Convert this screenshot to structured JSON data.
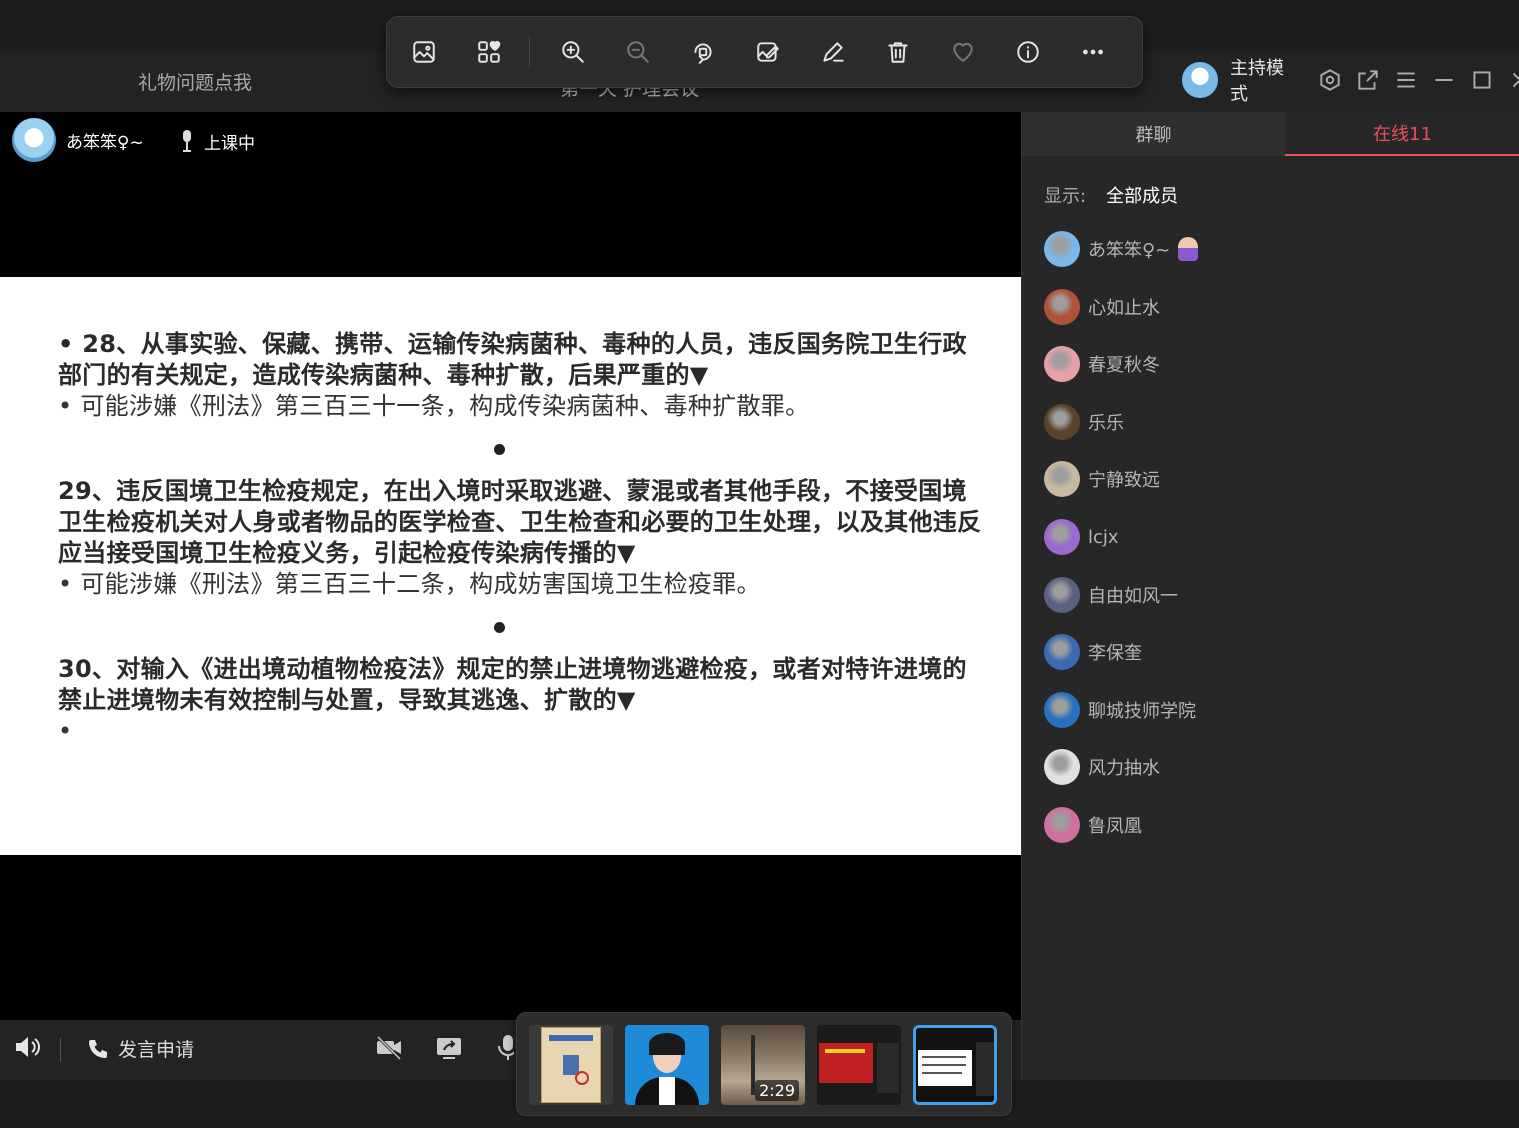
{
  "window": {
    "gift_link": "礼物问题点我",
    "center_title": "第一天 护理会议",
    "host_mode_label": "主持模式"
  },
  "viewer_toolbar": {
    "buttons": [
      "image-icon",
      "apps-heart-icon",
      "zoom-in-icon",
      "zoom-out-icon",
      "rotate-icon",
      "edit-image-icon",
      "draw-icon",
      "delete-icon",
      "favorite-icon",
      "info-icon",
      "more-icon"
    ]
  },
  "presenter": {
    "name": "あ笨笨♀~",
    "status": "上课中"
  },
  "slide": {
    "item28_title": "•   28、从事实验、保藏、携带、运输传染病菌种、毒种的人员，违反国务院卫生行政部门的有关规定，造成传染病菌种、毒种扩散，后果严重的▼",
    "item28_answer": "•   可能涉嫌《刑法》第三百三十一条，构成传染病菌种、毒种扩散罪。",
    "item29_title": "29、违反国境卫生检疫规定，在出入境时采取逃避、蒙混或者其他手段，不接受国境卫生检疫机关对人身或者物品的医学检查、卫生检查和必要的卫生处理，以及其他违反应当接受国境卫生检疫义务，引起检疫传染病传播的▼",
    "item29_answer": "•   可能涉嫌《刑法》第三百三十二条，构成妨害国境卫生检疫罪。",
    "item30_title": "30、对输入《进出境动植物检疫法》规定的禁止进境物逃避检疫，或者对特许进境的禁止进境物未有效控制与处置，导致其逃逸、扩散的▼",
    "item30_answer": "•"
  },
  "bottom_bar": {
    "apply_speak": "发言申请"
  },
  "filmstrip": {
    "video_duration": "2:29",
    "selected_index": 4
  },
  "right_panel": {
    "tabs": [
      "群聊",
      "在线11"
    ],
    "filter_label": "显示:",
    "filter_value": "全部成员",
    "members": [
      {
        "name": "あ笨笨♀~",
        "color": "#7ab8e8"
      },
      {
        "name": "心如止水",
        "color": "#b0523a"
      },
      {
        "name": "春夏秋冬",
        "color": "#e8a0a8"
      },
      {
        "name": "乐乐",
        "color": "#5a4328"
      },
      {
        "name": "宁静致远",
        "color": "#c8b8a0"
      },
      {
        "name": "lcjx",
        "color": "#9a6ad0"
      },
      {
        "name": "自由如风一",
        "color": "#5a6080"
      },
      {
        "name": "李保奎",
        "color": "#3a6ab0"
      },
      {
        "name": "聊城技师学院",
        "color": "#2a70c0"
      },
      {
        "name": "风力抽水",
        "color": "#e0e0e0"
      },
      {
        "name": "鲁凤凰",
        "color": "#d070a0"
      }
    ]
  },
  "colors": {
    "accent": "#e8515c",
    "selection": "#3fa0f0"
  }
}
